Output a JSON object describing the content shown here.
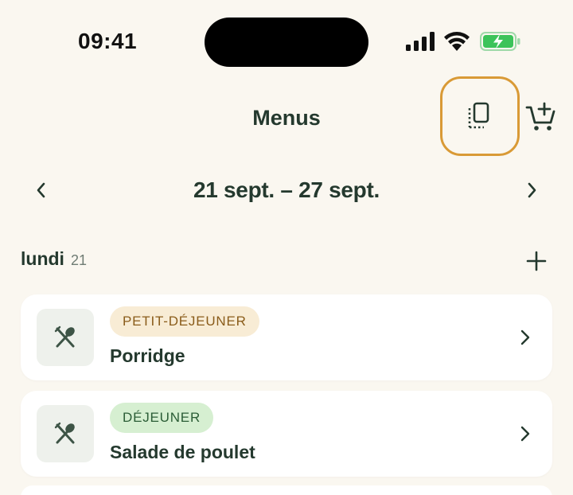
{
  "status_bar": {
    "time": "09:41"
  },
  "header": {
    "title": "Menus",
    "copy_icon": "copy-menu-icon",
    "cart_icon": "add-to-cart-icon"
  },
  "week": {
    "label": "21 sept. – 27 sept."
  },
  "day": {
    "name": "lundi",
    "number": "21"
  },
  "meals": [
    {
      "tag": "PETIT-DÉJEUNER",
      "name": "Porridge",
      "icon": "fork-spoon-icon"
    },
    {
      "tag": "DÉJEUNER",
      "name": "Salade de poulet",
      "icon": "fork-spoon-icon"
    }
  ],
  "colors": {
    "background": "#faf7f0",
    "text": "#24392e",
    "highlight": "#d99a36",
    "battery": "#3cc35a"
  }
}
